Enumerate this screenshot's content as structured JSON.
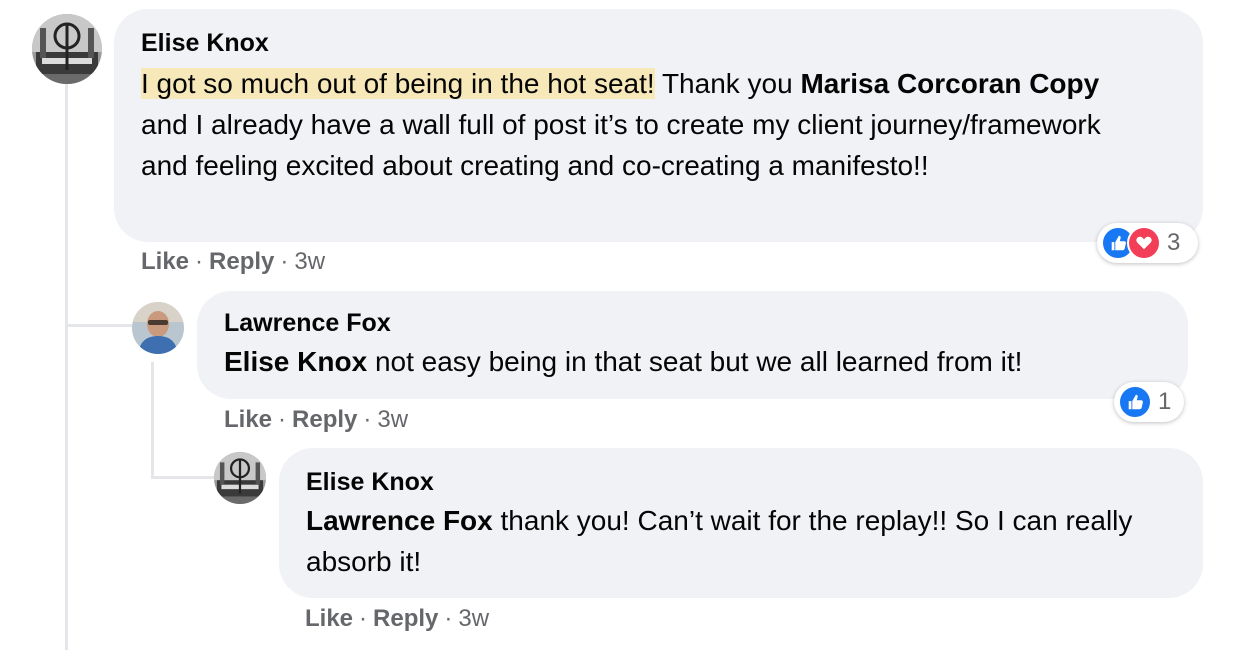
{
  "comments": [
    {
      "author": "Elise Knox",
      "highlighted": "I got so much out of being in the hot seat!",
      "text_1": " Thank you ",
      "mention": "Marisa Corcoran Copy",
      "text_2": " and I already have a wall full of post it’s to create my client journey/framework and feeling excited about creating and co-creating a manifesto!!",
      "like": "Like",
      "reply": "Reply",
      "time": "3w",
      "reaction_count": "3",
      "reactions": [
        "like-icon",
        "love-icon"
      ]
    },
    {
      "author": "Lawrence Fox",
      "mention": "Elise Knox",
      "text": " not easy being in that seat but we all learned from it!",
      "like": "Like",
      "reply": "Reply",
      "time": "3w",
      "reaction_count": "1",
      "reactions": [
        "like-icon"
      ]
    },
    {
      "author": "Elise Knox",
      "mention": "Lawrence Fox",
      "text": " thank you! Can’t wait for the replay!! So I can really absorb it!",
      "like": "Like",
      "reply": "Reply",
      "time": "3w"
    }
  ],
  "separator": "·",
  "colors": {
    "bubble": "#f0f2f5",
    "meta": "#65676b",
    "like_blue": "#1877f2",
    "love_red": "#f33e58",
    "highlight": "#f6e8b9"
  }
}
